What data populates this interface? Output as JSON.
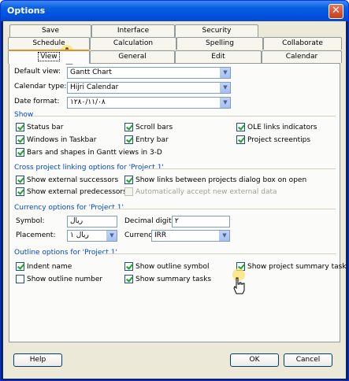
{
  "window": {
    "title": "Options",
    "close_glyph": "✕"
  },
  "tabs": {
    "row1": [
      "Save",
      "Interface",
      "Security"
    ],
    "row2": [
      "Schedule",
      "Calculation",
      "Spelling",
      "Collaborate"
    ],
    "row3": [
      "View",
      "General",
      "Edit",
      "Calendar"
    ],
    "active": "View"
  },
  "view": {
    "default_view": {
      "label": "Default view:",
      "value": "Gantt Chart"
    },
    "calendar_type": {
      "label": "Calendar type:",
      "value": "Hijri Calendar"
    },
    "date_format": {
      "label": "Date format:",
      "value": "۱۲۸۰/۱۱/۰۸"
    }
  },
  "show": {
    "title": "Show",
    "status_bar": "Status bar",
    "windows_in_taskbar": "Windows in Taskbar",
    "bars_shapes": "Bars and shapes in Gantt views in 3-D",
    "scroll_bars": "Scroll bars",
    "entry_bar": "Entry bar",
    "ole_links": "OLE links indicators",
    "project_screentips": "Project screentips"
  },
  "cross": {
    "title": "Cross project linking options for 'Project 1'",
    "external_successors": "Show external successors",
    "external_predecessors": "Show external predecessors",
    "links_between": "Show links between projects dialog box on open",
    "auto_accept": "Automatically accept new external data"
  },
  "currency": {
    "title": "Currency options for 'Project 1'",
    "symbol_label": "Symbol:",
    "symbol_value": "ریال",
    "placement_label": "Placement:",
    "placement_value": "ریال ۱",
    "decimal_label": "Decimal digits:",
    "decimal_value": "۲",
    "currency_label": "Currency:",
    "currency_value": "IRR"
  },
  "outline": {
    "title": "Outline options for 'Project 1'",
    "indent_name": "Indent name",
    "show_outline_number": "Show outline number",
    "show_outline_symbol": "Show outline symbol",
    "show_summary_tasks": "Show summary tasks",
    "show_project_summary": "Show project summary task"
  },
  "buttons": {
    "help": "Help",
    "ok": "OK",
    "cancel": "Cancel"
  }
}
